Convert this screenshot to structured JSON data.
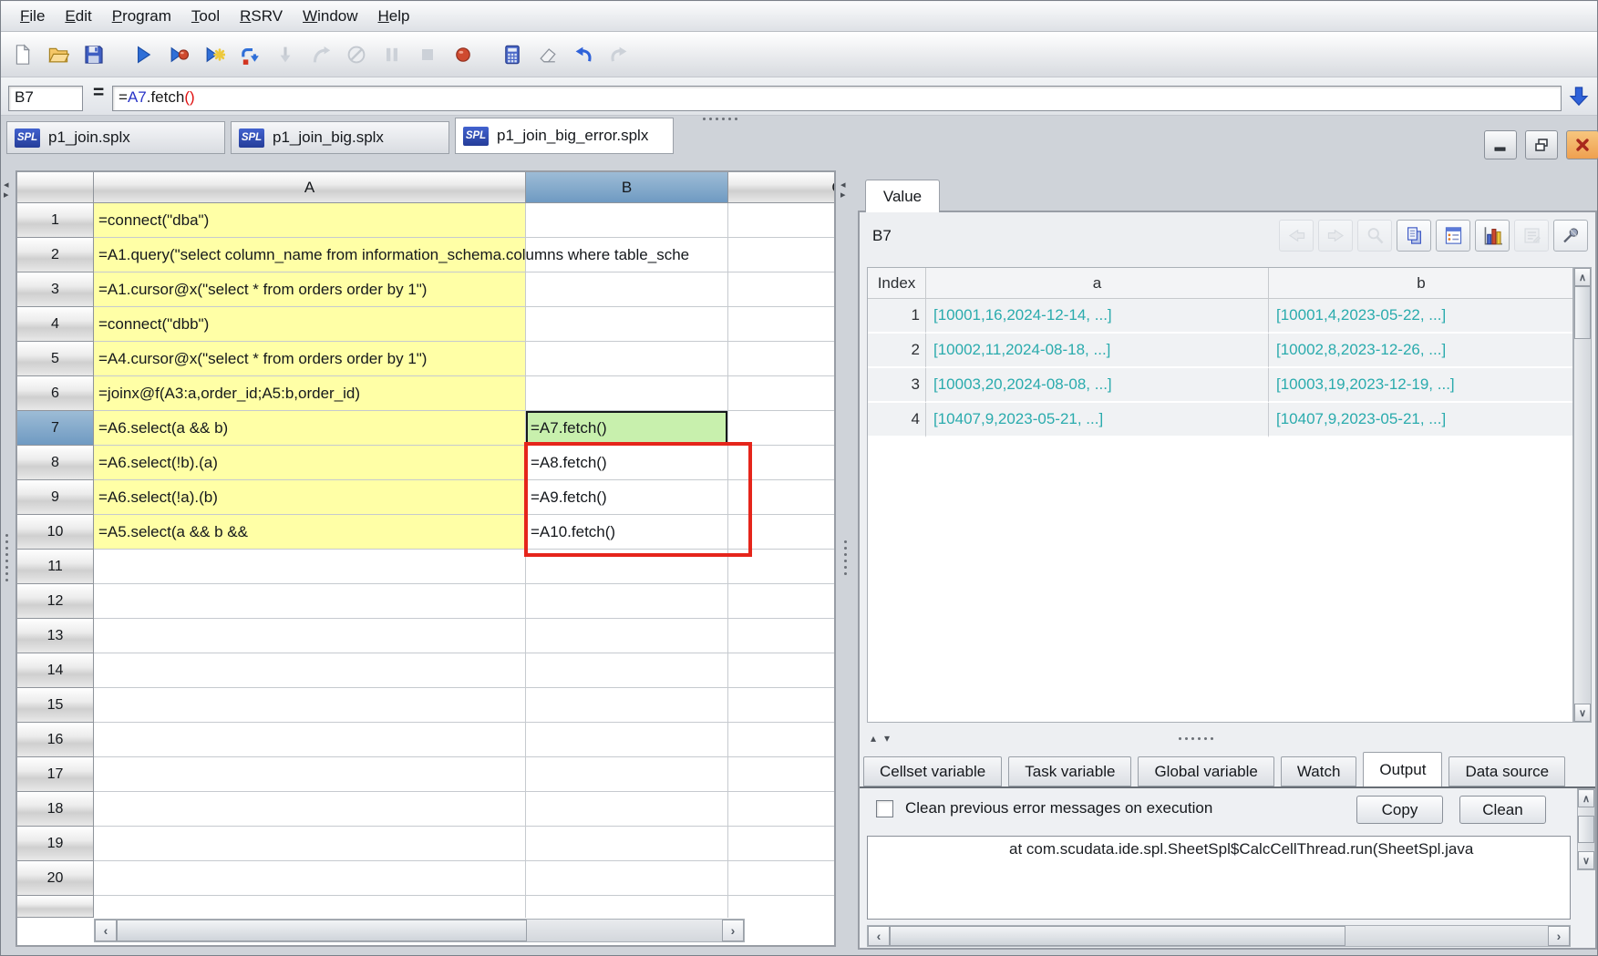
{
  "menu": {
    "items": [
      {
        "label": "File"
      },
      {
        "label": "Edit"
      },
      {
        "label": "Program"
      },
      {
        "label": "Tool"
      },
      {
        "label": "RSRV"
      },
      {
        "label": "Window"
      },
      {
        "label": "Help"
      }
    ]
  },
  "toolbar": {
    "buttons": [
      {
        "icon": "new-file-icon",
        "enabled": true
      },
      {
        "icon": "open-file-icon",
        "enabled": true
      },
      {
        "icon": "save-icon",
        "enabled": true
      },
      {
        "sep": true
      },
      {
        "icon": "execute-icon",
        "enabled": true
      },
      {
        "icon": "execute-debug-icon",
        "enabled": true
      },
      {
        "icon": "calc-current-icon",
        "enabled": true
      },
      {
        "icon": "step-next-icon",
        "enabled": true
      },
      {
        "icon": "step-into-icon",
        "enabled": false
      },
      {
        "icon": "step-return-icon",
        "enabled": false
      },
      {
        "icon": "cancel-icon",
        "enabled": false
      },
      {
        "icon": "pause-icon",
        "enabled": false
      },
      {
        "icon": "stop-icon",
        "enabled": false
      },
      {
        "icon": "breakpoint-icon",
        "enabled": true
      },
      {
        "sep": true
      },
      {
        "icon": "calc-area-icon",
        "enabled": true
      },
      {
        "icon": "clear-icon",
        "enabled": true
      },
      {
        "icon": "undo-icon",
        "enabled": true
      },
      {
        "icon": "redo-icon",
        "enabled": false
      }
    ]
  },
  "formula_bar": {
    "cell_ref": "B7",
    "equals_label": "=",
    "formula": [
      {
        "text": "=",
        "color": "#1a1a1a"
      },
      {
        "text": "A7",
        "color": "#2a35c8"
      },
      {
        "text": ".fetch",
        "color": "#1a1a1a"
      },
      {
        "text": "()",
        "color": "#e01212"
      }
    ]
  },
  "file_tabs": [
    {
      "badge": "SPL",
      "label": "p1_join.splx",
      "active": false
    },
    {
      "badge": "SPL",
      "label": "p1_join_big.splx",
      "active": false
    },
    {
      "badge": "SPL",
      "label": "p1_join_big_error.splx",
      "active": true
    }
  ],
  "window_controls": [
    {
      "name": "minimize-button",
      "icon": "minimize-icon"
    },
    {
      "name": "restore-button",
      "icon": "restore-icon"
    },
    {
      "name": "close-button",
      "icon": "close-icon"
    }
  ],
  "grid": {
    "column_headers": [
      "A",
      "B",
      "C"
    ],
    "selected_column": "B",
    "selected_row": 7,
    "selected_cell": "B7",
    "rows": [
      {
        "n": "1",
        "a": "=connect(\"dba\")",
        "b": ""
      },
      {
        "n": "2",
        "a": "=A1.query(\"select column_name from information_schema.columns where table_sche",
        "b": ""
      },
      {
        "n": "3",
        "a": "=A1.cursor@x(\"select * from orders order by 1\")",
        "b": ""
      },
      {
        "n": "4",
        "a": "=connect(\"dbb\")",
        "b": ""
      },
      {
        "n": "5",
        "a": "=A4.cursor@x(\"select * from orders order by 1\")",
        "b": ""
      },
      {
        "n": "6",
        "a": "=joinx@f(A3:a,order_id;A5:b,order_id)",
        "b": ""
      },
      {
        "n": "7",
        "a": "=A6.select(a && b)",
        "b": "=A7.fetch()"
      },
      {
        "n": "8",
        "a": "=A6.select(!b).(a)",
        "b": "=A8.fetch()"
      },
      {
        "n": "9",
        "a": "=A6.select(!a).(b)",
        "b": "=A9.fetch()"
      },
      {
        "n": "10",
        "a": "=A5.select(a && b &&",
        "b": "=A10.fetch()"
      },
      {
        "n": "11",
        "a": "",
        "b": ""
      },
      {
        "n": "12",
        "a": "",
        "b": ""
      },
      {
        "n": "13",
        "a": "",
        "b": ""
      },
      {
        "n": "14",
        "a": "",
        "b": ""
      },
      {
        "n": "15",
        "a": "",
        "b": ""
      },
      {
        "n": "16",
        "a": "",
        "b": ""
      },
      {
        "n": "17",
        "a": "",
        "b": ""
      },
      {
        "n": "18",
        "a": "",
        "b": ""
      },
      {
        "n": "19",
        "a": "",
        "b": ""
      },
      {
        "n": "20",
        "a": "",
        "b": ""
      }
    ]
  },
  "value_panel": {
    "tab_label": "Value",
    "cell_ref": "B7",
    "toolbar": [
      {
        "icon": "back-icon",
        "enabled": false
      },
      {
        "icon": "forward-icon",
        "enabled": false
      },
      {
        "icon": "zoom-value-icon",
        "enabled": false
      },
      {
        "icon": "copy-value-icon",
        "enabled": true
      },
      {
        "icon": "form-view-icon",
        "enabled": true
      },
      {
        "icon": "chart-icon",
        "enabled": true
      },
      {
        "icon": "properties-icon",
        "enabled": false
      },
      {
        "icon": "pin-icon",
        "enabled": true
      }
    ],
    "table": {
      "headers": [
        "Index",
        "a",
        "b"
      ],
      "rows": [
        {
          "index": "1",
          "a": "[10001,16,2024-12-14, ...]",
          "b": "[10001,4,2023-05-22, ...]"
        },
        {
          "index": "2",
          "a": "[10002,11,2024-08-18, ...]",
          "b": "[10002,8,2023-12-26, ...]"
        },
        {
          "index": "3",
          "a": "[10003,20,2024-08-08, ...]",
          "b": "[10003,19,2023-12-19, ...]"
        },
        {
          "index": "4",
          "a": "[10407,9,2023-05-21, ...]",
          "b": "[10407,9,2023-05-21, ...]"
        }
      ]
    }
  },
  "bottom_tabs": [
    {
      "label": "Cellset variable",
      "active": false
    },
    {
      "label": "Task variable",
      "active": false
    },
    {
      "label": "Global variable",
      "active": false
    },
    {
      "label": "Watch",
      "active": false
    },
    {
      "label": "Output",
      "active": true
    },
    {
      "label": "Data source",
      "active": false
    }
  ],
  "output_panel": {
    "checkbox_label": "Clean previous error messages on execution",
    "checkbox_checked": false,
    "copy_label": "Copy",
    "clean_label": "Clean",
    "error_line": "at com.scudata.ide.spl.SheetSpl$CalcCellThread.run(SheetSpl.java"
  },
  "icons": {
    "scroll-left-icon": "‹",
    "scroll-right-icon": "›",
    "scroll-up-icon": "∧",
    "scroll-down-icon": "∨",
    "splitter-left-icon": "◂",
    "splitter-right-icon": "▸",
    "splitter-up-icon": "▴",
    "splitter-down-icon": "▾"
  },
  "colors": {
    "cell_yellow": "#ffffa6",
    "selected_cell_green": "#c8f0ad",
    "selected_header_blue": "#79a0c2",
    "annotation_red": "#e5251b",
    "value_teal": "#2aabad",
    "formula_ref_blue": "#2a35c8",
    "formula_paren_red": "#e01212"
  }
}
